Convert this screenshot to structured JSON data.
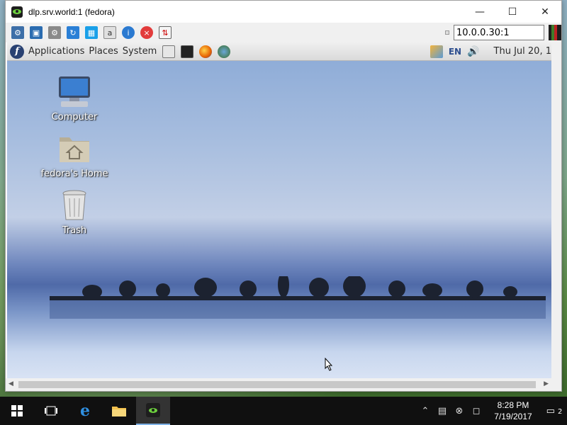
{
  "window": {
    "title": "dlp.srv.world:1 (fedora)",
    "minimize_icon": "minimize-icon",
    "maximize_icon": "maximize-icon",
    "close_icon": "close-icon"
  },
  "toolbar": {
    "host_address": "10.0.0.30:1",
    "buttons": [
      "options-icon",
      "fullscreen-icon",
      "settings-gear-icon",
      "refresh-icon",
      "windows-key-icon",
      "clipboard-icon",
      "info-icon",
      "disconnect-icon",
      "file-transfer-icon"
    ]
  },
  "gnome_panel": {
    "menus": [
      "Applications",
      "Places",
      "System"
    ],
    "launchers": [
      "terminal-icon",
      "firefox-icon",
      "network-icon"
    ],
    "language": "EN",
    "clock": "Thu Jul 20, 1"
  },
  "desktop": {
    "icons": [
      {
        "label": "Computer",
        "icon": "computer-icon"
      },
      {
        "label": "fedora's Home",
        "icon": "home-folder-icon"
      },
      {
        "label": "Trash",
        "icon": "trash-icon"
      }
    ]
  },
  "taskbar": {
    "time": "8:28 PM",
    "date": "7/19/2017",
    "notifications": "2",
    "apps": [
      "start-icon",
      "task-view-icon",
      "edge-icon",
      "file-explorer-icon",
      "vnc-viewer-icon"
    ]
  },
  "colors": {
    "taskbar_bg": "#101010",
    "fedora_blue": "#294172",
    "accent": "#7fb2e6"
  }
}
